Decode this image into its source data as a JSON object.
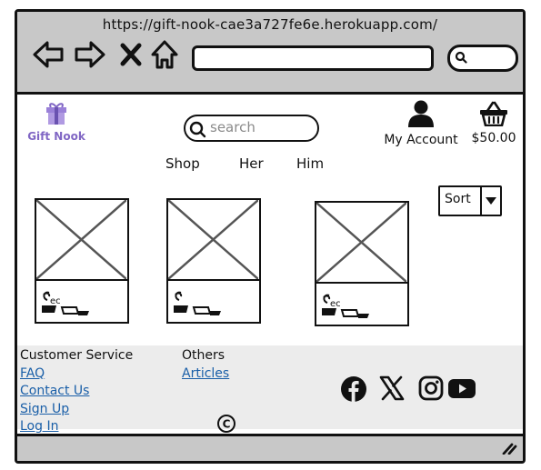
{
  "browser": {
    "url": "https://gift-nook-cae3a727fe6e.herokuapp.com/",
    "icons": [
      "back-arrow-icon",
      "forward-arrow-icon",
      "close-icon",
      "home-icon",
      "search-icon"
    ]
  },
  "header": {
    "logo_text": "Gift Nook",
    "logo_icon": "gift-box-icon",
    "search_placeholder": "search",
    "account_label": "My Account",
    "cart_total": "$50.00"
  },
  "nav": {
    "items": [
      "Shop",
      "Her",
      "Him"
    ]
  },
  "sort": {
    "label": "Sort"
  },
  "products": [
    {
      "image": "placeholder-image-icon"
    },
    {
      "image": "placeholder-image-icon"
    },
    {
      "image": "placeholder-image-icon"
    }
  ],
  "footer": {
    "customer_service": {
      "heading": "Customer Service",
      "links": [
        "FAQ",
        "Contact Us",
        "Sign Up",
        "Log In"
      ]
    },
    "others": {
      "heading": "Others",
      "links": [
        "Articles"
      ]
    },
    "social_icons": [
      "facebook-icon",
      "x-icon",
      "instagram-icon",
      "youtube-icon"
    ],
    "copyright_symbol": "©"
  },
  "colors": {
    "chrome": "#c8c8c8",
    "footer_bg": "#ececec",
    "link": "#1a5fa8",
    "logo": "#8066c4"
  }
}
